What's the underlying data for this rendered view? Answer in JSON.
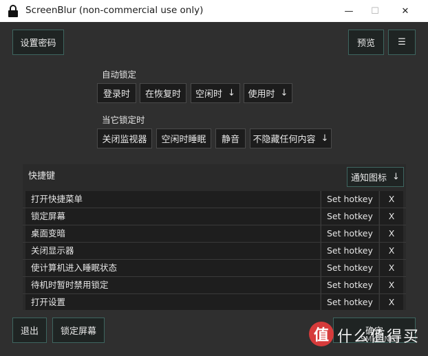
{
  "window": {
    "title": "ScreenBlur (non-commercial use only)",
    "min_glyph": "—",
    "max_glyph": "☐",
    "close_glyph": "✕"
  },
  "toolbar": {
    "set_password": "设置密码",
    "preview": "预览",
    "menu_glyph": "☰"
  },
  "auto_lock": {
    "label": "自动锁定",
    "options": [
      "登录时",
      "在恢复时",
      "空闲时",
      "使用时"
    ],
    "arrow": "↓"
  },
  "when_locked": {
    "label": "当它锁定时",
    "options": [
      "关闭监视器",
      "空闲时睡眠",
      "静音",
      "不隐藏任何内容"
    ],
    "arrow": "↓"
  },
  "hotkeys": {
    "title": "快捷键",
    "notify_icon": "通知图标",
    "arrow": "↓",
    "set_label": "Set hotkey",
    "clear_label": "X",
    "rows": [
      "打开快捷菜单",
      "锁定屏幕",
      "桌面变暗",
      "关闭显示器",
      "使计算机进入睡眠状态",
      "待机时暂时禁用锁定",
      "打开设置"
    ]
  },
  "footer": {
    "exit": "退出",
    "lock_screen": "锁定屏幕",
    "confirm": "确定"
  },
  "watermark": {
    "logo": "值",
    "text": "什么值得买",
    "sub": "SMYZ.NET"
  },
  "colors": {
    "app_bg": "#2f2f2f",
    "button_bg": "#1f2423",
    "button_border": "#3e6660",
    "row_bg": "#1e1e1e"
  }
}
